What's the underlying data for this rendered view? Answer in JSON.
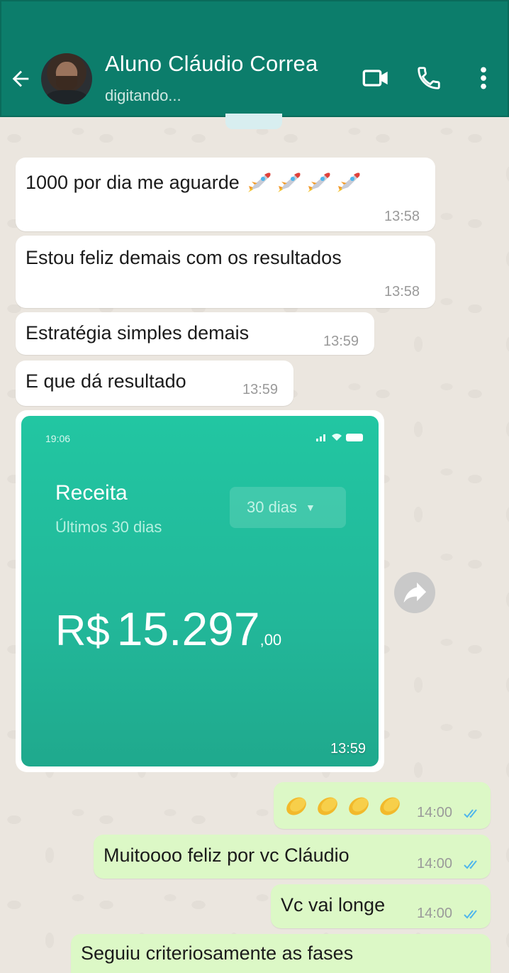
{
  "header": {
    "contact_name": "Aluno Cláudio Correa",
    "status": "digitando...",
    "icons": [
      "back-arrow-icon",
      "video-call-icon",
      "phone-icon",
      "more-vert-icon"
    ],
    "bg_color": "#0c7d6b"
  },
  "messages": [
    {
      "direction": "in",
      "text": "1000 por dia me aguarde",
      "emoji": "rocket x4",
      "time": "13:58"
    },
    {
      "direction": "in",
      "text": "Estou feliz demais com os resultados",
      "time": "13:58"
    },
    {
      "direction": "in",
      "text": "Estratégia simples demais",
      "time": "13:59"
    },
    {
      "direction": "in",
      "text": "E que dá resultado",
      "time": "13:59"
    },
    {
      "direction": "out",
      "emoji": "clapping hands x4",
      "time": "14:00",
      "status": "read"
    },
    {
      "direction": "out",
      "text": "Muitoooo feliz por vc Cláudio",
      "time": "14:00",
      "status": "read"
    },
    {
      "direction": "out",
      "text": "Vc vai longe",
      "time": "14:00",
      "status": "read"
    },
    {
      "direction": "out",
      "text": "Seguiu criteriosamente as fases"
    }
  ],
  "image_message": {
    "phone_time": "19:06",
    "title": "Receita",
    "subtitle": "Últimos 30 dias",
    "period_dropdown": "30 dias",
    "currency": "R$",
    "amount": "15.297",
    "cents": ",00",
    "time": "13:59"
  },
  "colors": {
    "incoming_bubble": "#ffffff",
    "outgoing_bubble": "#dcf8c6",
    "read_ticks": "#4fb6ec"
  }
}
